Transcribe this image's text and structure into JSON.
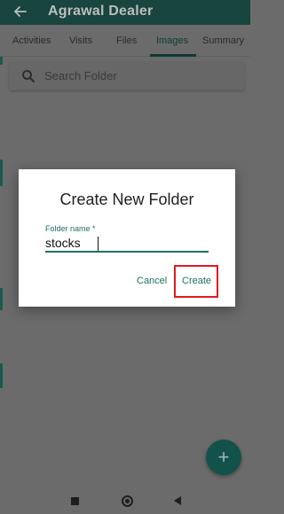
{
  "appbar": {
    "title": "Agrawal Dealer",
    "back_icon": "arrow-left-icon"
  },
  "tabs": [
    {
      "label": "Activities"
    },
    {
      "label": "Visits"
    },
    {
      "label": "Files"
    },
    {
      "label": "Images",
      "active": true
    },
    {
      "label": "Summary"
    }
  ],
  "search": {
    "placeholder": "Search Folder",
    "icon": "search-icon"
  },
  "dialog": {
    "title": "Create New Folder",
    "field_label": "Folder name *",
    "field_value": "stocks",
    "cancel_label": "Cancel",
    "create_label": "Create",
    "highlight_color": "#e01a1a"
  },
  "fab": {
    "icon": "plus-icon",
    "symbol": "+"
  },
  "navbar": {
    "icons": [
      "recents-icon",
      "home-icon",
      "back-icon"
    ]
  },
  "colors": {
    "accent": "#1f6f66",
    "scrim": "#6b6b6b"
  }
}
